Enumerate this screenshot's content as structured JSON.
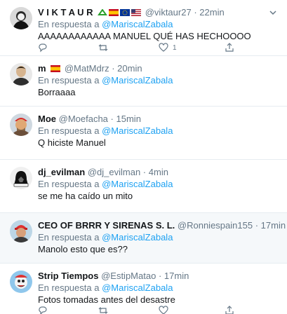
{
  "tweets": [
    {
      "name": "V I K T A U R",
      "emojis": [
        "recycle-icon",
        "spain-flag",
        "eu-flag",
        "usa-flag"
      ],
      "handle": "@viktaur27",
      "time": "22min",
      "reply_prefix": "En respuesta a",
      "reply_to": "@MariscalZabala",
      "text": "AAAAAAAAAAAA MANUEL QUÉ HAS HECHOOOO",
      "like_count": "1"
    },
    {
      "name": "m",
      "emojis": [
        "spain-flag"
      ],
      "handle": "@MatMdrz",
      "time": "20min",
      "reply_prefix": "En respuesta a",
      "reply_to": "@MariscalZabala",
      "text": "Borraaaa"
    },
    {
      "name": "Moe",
      "handle": "@Moefacha",
      "time": "15min",
      "reply_prefix": "En respuesta a",
      "reply_to": "@MariscalZabala",
      "text": "Q hiciste Manuel"
    },
    {
      "name": "dj_evilman",
      "handle": "@dj_evilman",
      "time": "4min",
      "reply_prefix": "En respuesta a",
      "reply_to": "@MariscalZabala",
      "text": "se me ha caído un mito"
    },
    {
      "name": "CEO OF BRRR Y SIRENAS S. L.",
      "handle": "@Ronniespain155",
      "time": "17min",
      "reply_prefix": "En respuesta a",
      "reply_to": "@MariscalZabala",
      "text": "Manolo esto que es??"
    },
    {
      "name": "Strip Tiempos",
      "handle": "@EstipMatao",
      "time": "17min",
      "reply_prefix": "En respuesta a",
      "reply_to": "@MariscalZabala",
      "text": "Fotos tomadas antes del desastre"
    }
  ],
  "separator": "·",
  "colors": {
    "accent": "#1da1f2",
    "muted": "#657786",
    "divider": "#e6ecf0",
    "highlight_bg": "#f5f8fa"
  }
}
